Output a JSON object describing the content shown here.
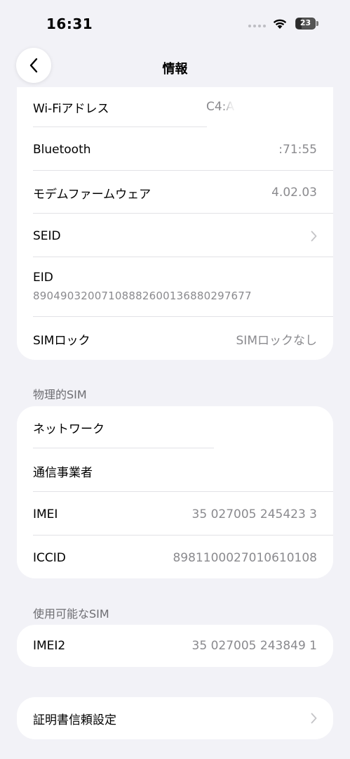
{
  "status_bar": {
    "time": "16:31",
    "battery": "23"
  },
  "nav": {
    "title": "情報"
  },
  "info_group": {
    "wifi_label": "Wi-Fiアドレス",
    "wifi_value": "C4:A",
    "bluetooth_label": "Bluetooth",
    "bluetooth_value": ":71:55",
    "modem_label": "モデムファームウェア",
    "modem_value": "4.02.03",
    "seid_label": "SEID",
    "eid_label": "EID",
    "eid_value": "89049032007108882600136880297677",
    "simlock_label": "SIMロック",
    "simlock_value": "SIMロックなし"
  },
  "physical_sim": {
    "header": "物理的SIM",
    "network_label": "ネットワーク",
    "carrier_label": "通信事業者",
    "imei_label": "IMEI",
    "imei_value": "35 027005 245423 3",
    "iccid_label": "ICCID",
    "iccid_value": "8981100027010610108"
  },
  "available_sim": {
    "header": "使用可能なSIM",
    "imei2_label": "IMEI2",
    "imei2_value": "35 027005 243849 1"
  },
  "cert_group": {
    "cert_label": "証明書信頼設定"
  },
  "colors": {
    "background": "#f2f2f7",
    "card": "#ffffff",
    "secondary_text": "#8a8a8e",
    "section_header": "#6d6d72"
  }
}
